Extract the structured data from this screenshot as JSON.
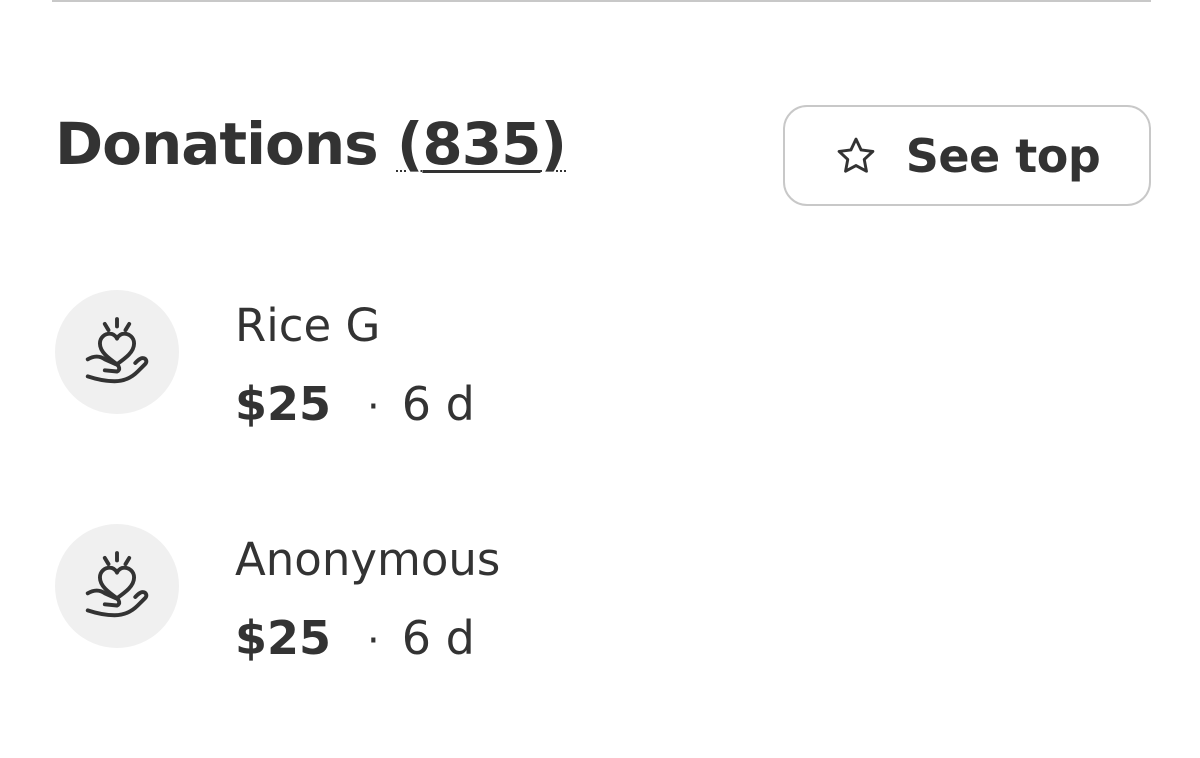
{
  "header": {
    "title": "Donations",
    "count": "835",
    "see_top_label": "See top"
  },
  "donations": [
    {
      "name": "Rice G",
      "amount": "$25",
      "separator": "·",
      "time": "6 d"
    },
    {
      "name": "Anonymous",
      "amount": "$25",
      "separator": "·",
      "time": "6 d"
    }
  ],
  "icons": {
    "see_top": "star-outline-icon",
    "donor_avatar": "heart-in-hand-icon"
  },
  "colors": {
    "text": "#333333",
    "avatar_bg": "#f0f0f0",
    "border": "#c8c8c8"
  }
}
